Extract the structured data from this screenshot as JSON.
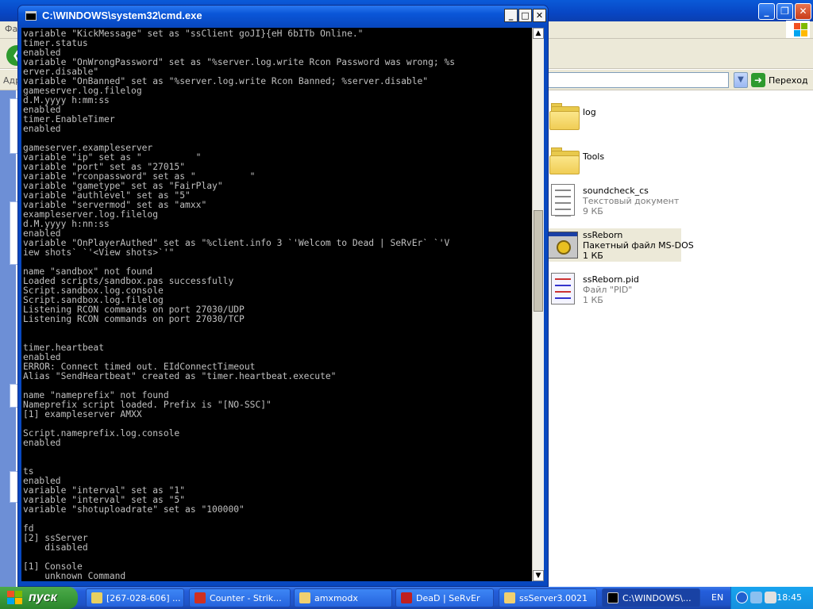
{
  "explorer": {
    "menu_fragment": "Фа",
    "address_fragment": "Адр",
    "go_label": "Переход",
    "files": [
      {
        "name": "log",
        "type": "folder"
      },
      {
        "name": "Tools",
        "type": "folder"
      },
      {
        "name": "soundcheck_cs",
        "sub1": "Текстовый документ",
        "sub2": "9 КБ",
        "type": "text"
      },
      {
        "name": "ssReborn",
        "sub1": "Пакетный файл MS-DOS",
        "sub2": "1 КБ",
        "type": "batch"
      },
      {
        "name": "ssReborn.pid",
        "sub1": "Файл \"PID\"",
        "sub2": "1 КБ",
        "type": "pid"
      }
    ]
  },
  "cmd": {
    "title": "C:\\WINDOWS\\system32\\cmd.exe",
    "lines": [
      "variable \"KickMessage\" set as \"ssClient goJI}{eH 6bITb Online.\"",
      "timer.status",
      "enabled",
      "variable \"OnWrongPassword\" set as \"%server.log.write Rcon Password was wrong; %s",
      "erver.disable\"",
      "variable \"OnBanned\" set as \"%server.log.write Rcon Banned; %server.disable\"",
      "gameserver.log.filelog",
      "d.M.yyyy h:mm:ss",
      "enabled",
      "timer.EnableTimer",
      "enabled",
      "",
      "gameserver.exampleserver",
      "variable \"ip\" set as \"          \"",
      "variable \"port\" set as \"27015\"",
      "variable \"rconpassword\" set as \"          \"",
      "variable \"gametype\" set as \"FairPlay\"",
      "variable \"authlevel\" set as \"5\"",
      "variable \"servermod\" set as \"amxx\"",
      "exampleserver.log.filelog",
      "d.M.yyyy h:nn:ss",
      "enabled",
      "variable \"OnPlayerAuthed\" set as \"%client.info 3 `'Welcom to Dead | SeRvEr` `'V",
      "iew shots` `'<View shots>`'\"",
      "",
      "name \"sandbox\" not found",
      "Loaded scripts/sandbox.pas successfully",
      "Script.sandbox.log.console",
      "Script.sandbox.log.filelog",
      "Listening RCON commands on port 27030/UDP",
      "Listening RCON commands on port 27030/TCP",
      "",
      "",
      "timer.heartbeat",
      "enabled",
      "ERROR: Connect timed out. EIdConnectTimeout",
      "Alias \"SendHeartbeat\" created as \"timer.heartbeat.execute\"",
      "",
      "name \"nameprefix\" not found",
      "Nameprefix script loaded. Prefix is \"[NO-SSC]\"",
      "[1] exampleserver AMXX",
      "",
      "Script.nameprefix.log.console",
      "enabled",
      "",
      "",
      "ts",
      "enabled",
      "variable \"interval\" set as \"1\"",
      "variable \"interval\" set as \"5\"",
      "variable \"shotuploadrate\" set as \"100000\"",
      "",
      "fd",
      "[2] ssServer",
      "    disabled",
      "",
      "[1] Console",
      "    unknown Command"
    ]
  },
  "taskbar": {
    "start_label": "пуск",
    "tasks": [
      {
        "label": "[267-028-606] ...",
        "color": "#e8d060"
      },
      {
        "label": "Counter - Strik...",
        "color": "#d03020"
      },
      {
        "label": "amxmodx",
        "color": "#f0d070"
      },
      {
        "label": "DeaD | SeRvEr",
        "color": "#c02020"
      },
      {
        "label": "ssServer3.0021",
        "color": "#f0d070"
      },
      {
        "label": "C:\\WINDOWS\\...",
        "color": "#000000"
      }
    ],
    "language": "EN",
    "clock": "18:45"
  }
}
